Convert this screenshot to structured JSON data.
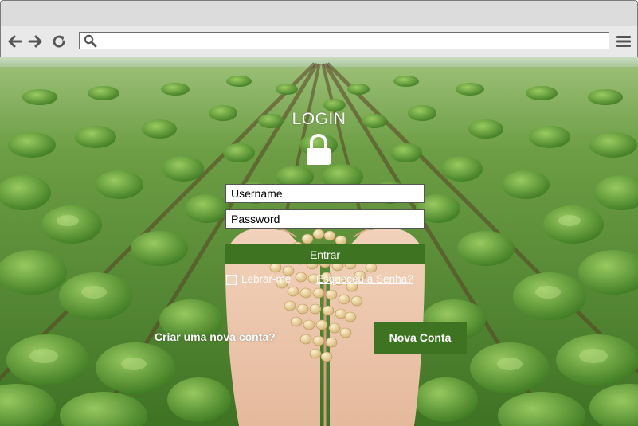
{
  "browser": {
    "toolbar": {
      "back_icon": "arrow-left-icon",
      "forward_icon": "arrow-right-icon",
      "reload_icon": "reload-icon",
      "search_icon": "search-icon",
      "menu_icon": "hamburger-menu-icon"
    },
    "url": ""
  },
  "login": {
    "title": "LOGIN",
    "lock_icon": "lock-icon",
    "username_placeholder": "Username",
    "password_placeholder": "Password",
    "submit_label": "Entrar",
    "remember_label": "Lebrar-me",
    "forgot_label": "Esqueceu a Senha?",
    "signup_text": "Criar uma nova conta?",
    "new_account_label": "Nova Conta"
  },
  "colors": {
    "button_green": "#3e7322",
    "text_white": "#ffffff",
    "chrome_gray": "#dcdcdc"
  }
}
